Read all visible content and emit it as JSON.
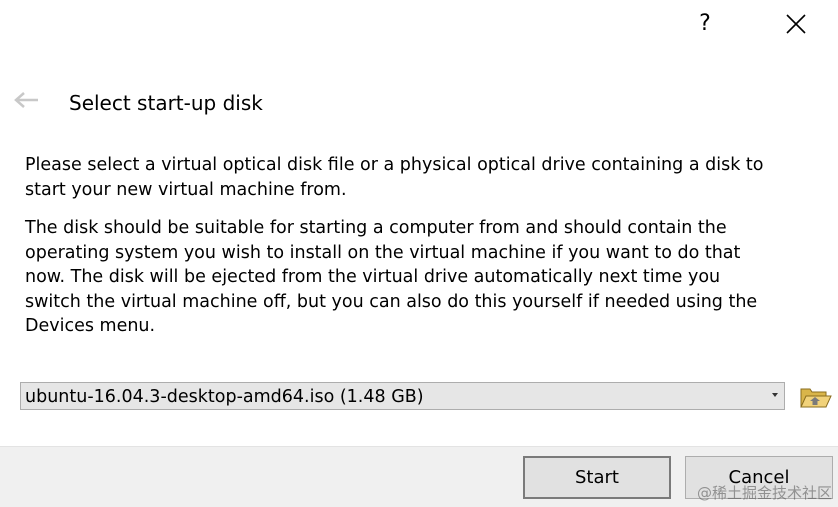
{
  "titlebar": {
    "help_label": "?",
    "close_icon": "close-icon"
  },
  "header": {
    "back_icon": "back-arrow-icon",
    "title": "Select start-up disk"
  },
  "body": {
    "paragraph1": "Please select a virtual optical disk file or a physical optical drive containing a disk to\nstart your new virtual machine from.",
    "paragraph2": "The disk should be suitable for starting a computer from and should contain the\noperating system you wish to install on the virtual machine if you want to do that\nnow. The disk will be ejected from the virtual drive automatically next time you\nswitch the virtual machine off, but you can also do this yourself if needed using the\nDevices menu."
  },
  "disk_select": {
    "selected_value": "ubuntu-16.04.3-desktop-amd64.iso (1.48 GB)",
    "folder_icon": "folder-open-icon"
  },
  "footer": {
    "start_label": "Start",
    "cancel_label": "Cancel"
  },
  "watermark": {
    "text": "@稀土掘金技术社区"
  },
  "colors": {
    "background": "#ffffff",
    "footer_background": "#f0f0f0",
    "button_background": "#e1e1e1",
    "combo_background": "#e6e6e6",
    "folder_icon_yellow": "#e8c25a"
  }
}
